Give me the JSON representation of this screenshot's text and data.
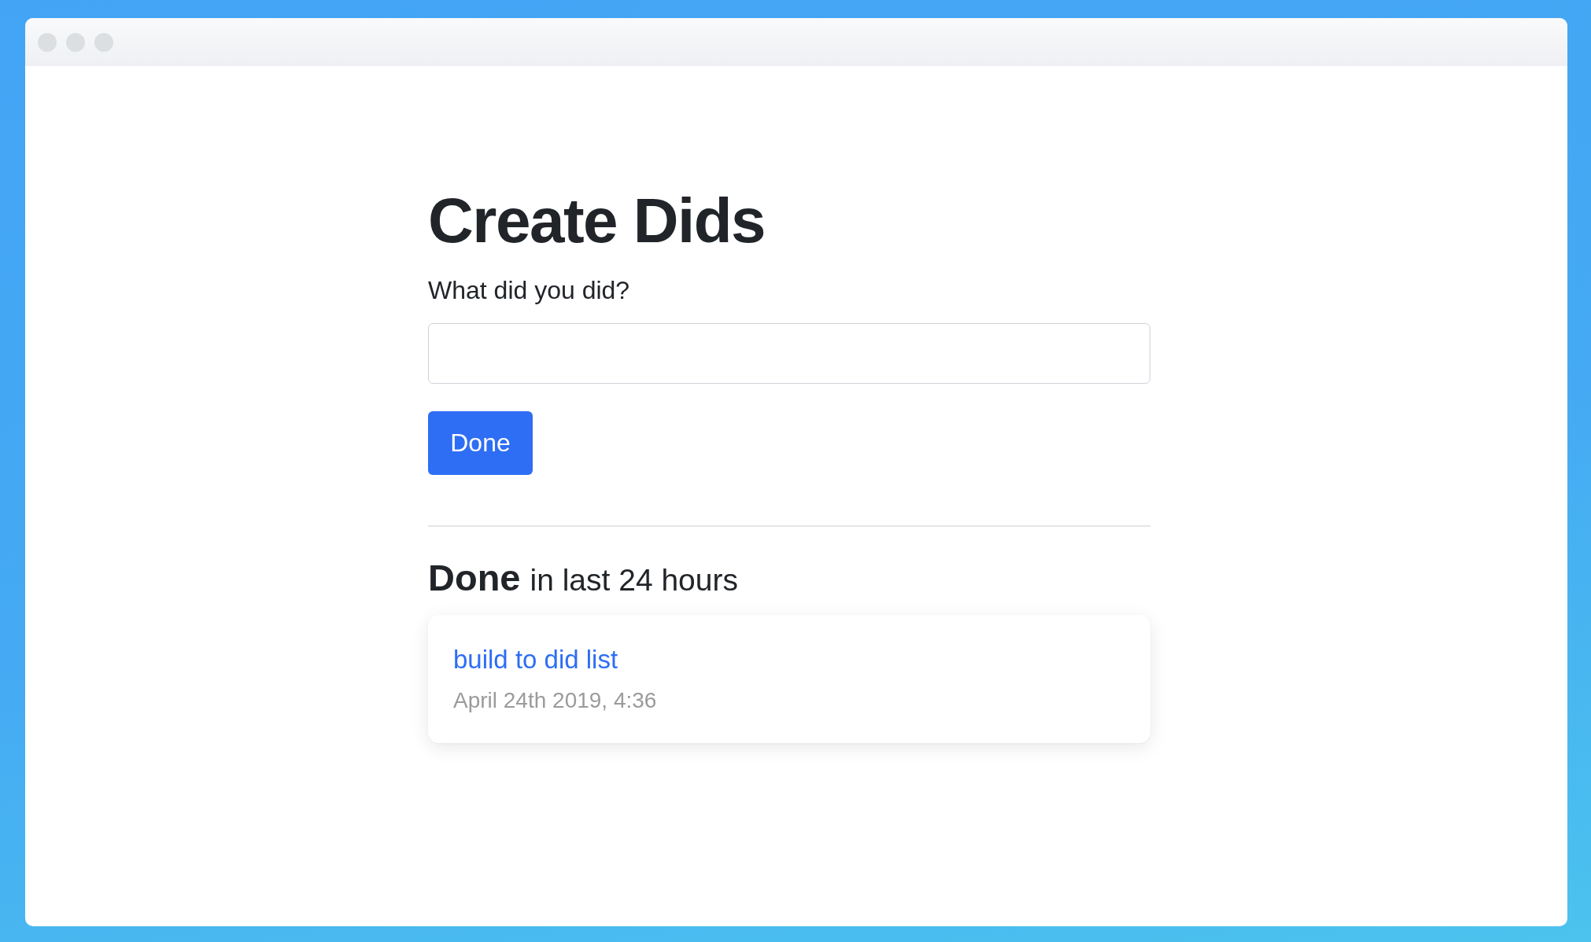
{
  "page": {
    "title": "Create Dids",
    "form": {
      "label": "What did you did?",
      "button": "Done"
    }
  },
  "recent": {
    "title": "Done",
    "caption": "in last 24 hours",
    "items": [
      {
        "text": "build to did list",
        "time": "April 24th 2019, 4:36"
      }
    ]
  }
}
